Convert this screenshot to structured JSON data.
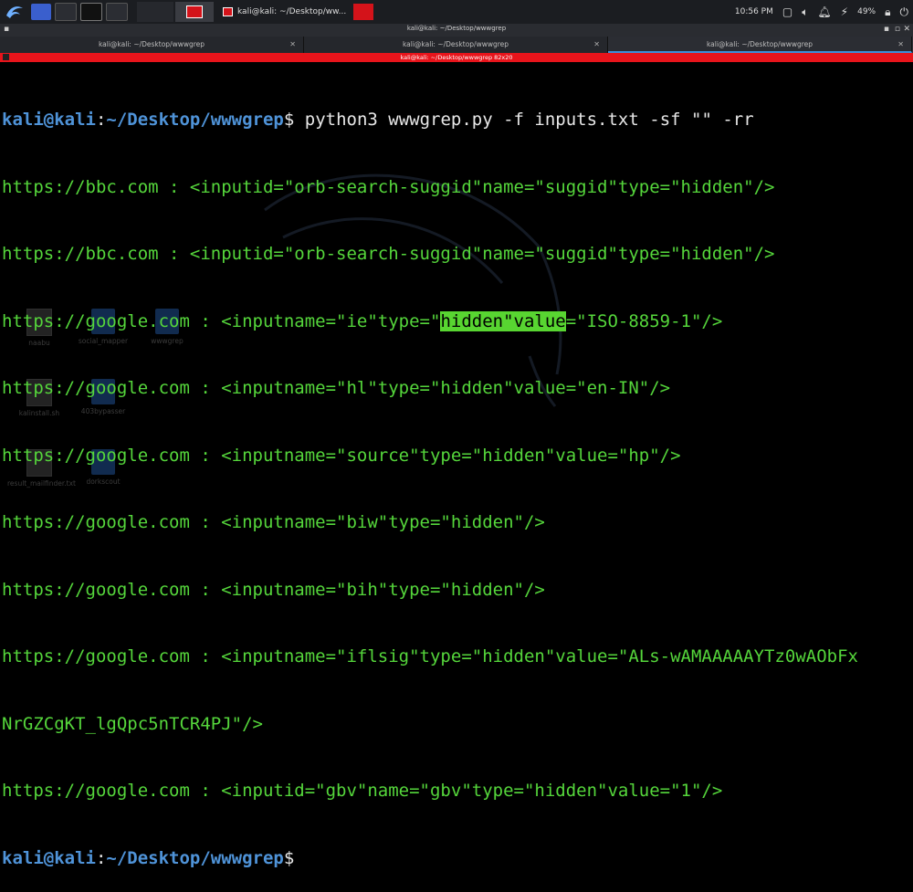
{
  "taskbar": {
    "clock": "10:56 PM",
    "battery": "49%",
    "task_label": "kali@kali: ~/Desktop/ww..."
  },
  "window": {
    "title": "kali@kali: ~/Desktop/wwwgrep"
  },
  "tabs": [
    {
      "label": "kali@kali: ~/Desktop/wwwgrep"
    },
    {
      "label": "kali@kali: ~/Desktop/wwwgrep"
    },
    {
      "label": "kali@kali: ~/Desktop/wwwgrep"
    }
  ],
  "terminal_header": {
    "title": "kali@kali: ~/Desktop/wwwgrep 82x20"
  },
  "prompt": {
    "user": "kali@kali",
    "sep": ":",
    "path": "~/Desktop/wwwgrep",
    "dollar": "$"
  },
  "command": " python3 wwwgrep.py -f inputs.txt -sf \"\" -rr",
  "output": [
    "https://bbc.com : <inputid=\"orb-search-suggid\"name=\"suggid\"type=\"hidden\"/>",
    "https://bbc.com : <inputid=\"orb-search-suggid\"name=\"suggid\"type=\"hidden\"/>",
    {
      "pre": "https://google.com : <inputname=\"ie\"type=\"",
      "hl": "hidden\"value",
      "post": "=\"ISO-8859-1\"/>"
    },
    "https://google.com : <inputname=\"hl\"type=\"hidden\"value=\"en-IN\"/>",
    "https://google.com : <inputname=\"source\"type=\"hidden\"value=\"hp\"/>",
    "https://google.com : <inputname=\"biw\"type=\"hidden\"/>",
    "https://google.com : <inputname=\"bih\"type=\"hidden\"/>",
    "https://google.com : <inputname=\"iflsig\"type=\"hidden\"value=\"ALs-wAMAAAAAYTz0wAObFx",
    "NrGZCgKT_lgQpc5nTCR4PJ\"/>",
    "https://google.com : <inputid=\"gbv\"name=\"gbv\"type=\"hidden\"value=\"1\"/>"
  ],
  "desktop_icons": [
    {
      "label": "naabu",
      "kind": "file"
    },
    {
      "label": "social_mapper",
      "kind": "folder"
    },
    {
      "label": "wwwgrep",
      "kind": "folder"
    },
    {
      "label": "kalinstall.sh",
      "kind": "file"
    },
    {
      "label": "403bypasser",
      "kind": "folder"
    },
    {
      "label": "result_mailfinder.txt",
      "kind": "file"
    },
    {
      "label": "dorkscout",
      "kind": "folder"
    }
  ]
}
